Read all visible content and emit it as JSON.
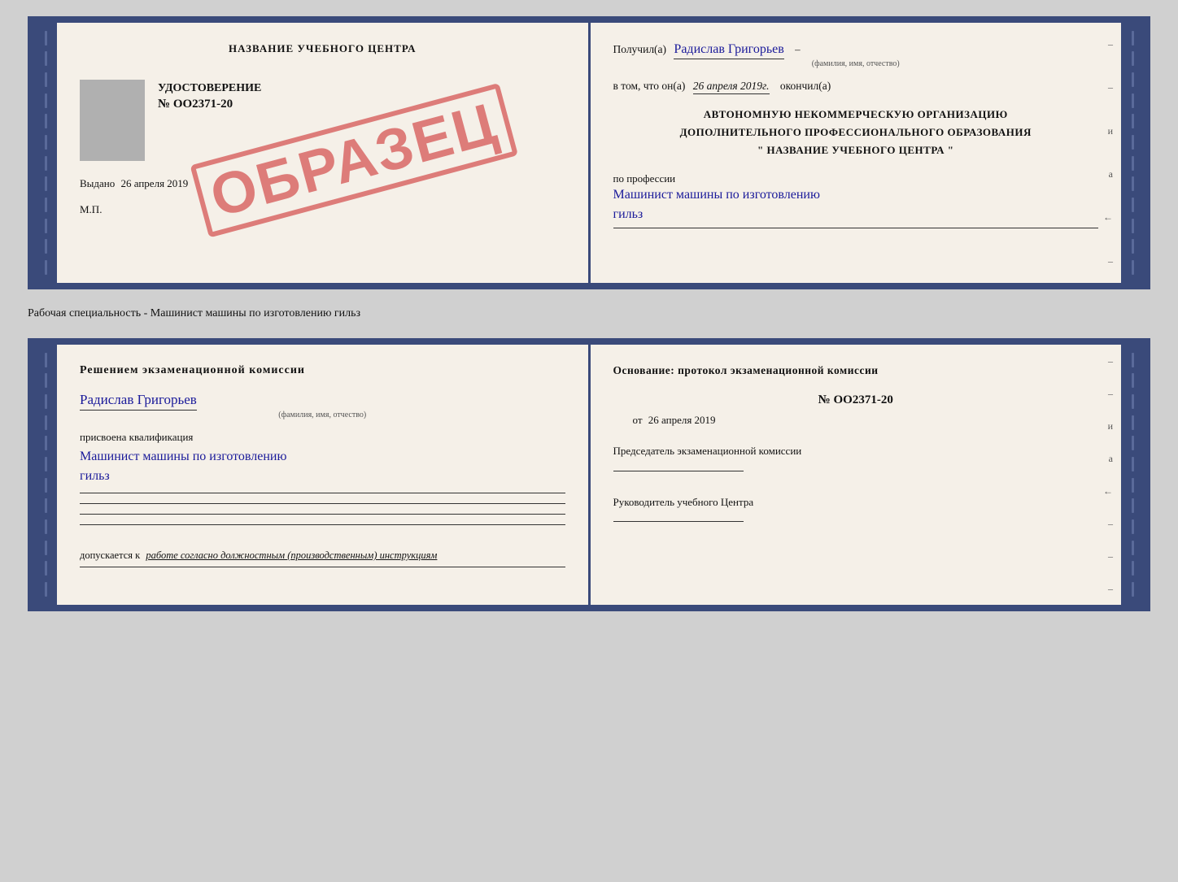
{
  "top_doc": {
    "left": {
      "title": "НАЗВАНИЕ УЧЕБНОГО ЦЕНТРА",
      "stamp": "ОБРАЗЕЦ",
      "cert_label": "УДОСТОВЕРЕНИЕ",
      "cert_number": "№ OO2371-20",
      "vydano_label": "Выдано",
      "vydano_date": "26 апреля 2019",
      "mp": "М.П."
    },
    "right": {
      "poluchil_label": "Получил(а)",
      "person_name": "Радислав Григорьев",
      "famiya_hint": "(фамилия, имя, отчество)",
      "vtom_label": "в том, что он(а)",
      "date": "26 апреля 2019г.",
      "okonchil_label": "окончил(а)",
      "org_line1": "АВТОНОМНУЮ НЕКОММЕРЧЕСКУЮ ОРГАНИЗАЦИЮ",
      "org_line2": "ДОПОЛНИТЕЛЬНОГО ПРОФЕССИОНАЛЬНОГО ОБРАЗОВАНИЯ",
      "org_quote1": "\"",
      "org_name": "НАЗВАНИЕ УЧЕБНОГО ЦЕНТРА",
      "org_quote2": "\"",
      "prof_label": "по профессии",
      "prof_name_line1": "Машинист машины по изготовлению",
      "prof_name_line2": "гильз"
    }
  },
  "separator_label": "Рабочая специальность - Машинист машины по изготовлению гильз",
  "bottom_doc": {
    "left": {
      "resheniem_title": "Решением  экзаменационной  комиссии",
      "person_name": "Радислав Григорьев",
      "famiya_hint": "(фамилия, имя, отчество)",
      "prisvoena_label": "присвоена квалификация",
      "kvalifc_line1": "Машинист машины по изготовлению",
      "kvalifc_line2": "гильз",
      "dopuskaetsya_label": "допускается к",
      "dopuskaetsya_text": "работе согласно должностным (производственным) инструкциям"
    },
    "right": {
      "osnovanie_title": "Основание: протокол экзаменационной  комиссии",
      "protocol_number": "№  OO2371-20",
      "ot_label": "от",
      "ot_date": "26 апреля 2019",
      "predsedatel_title": "Председатель экзаменационной комиссии",
      "rukovoditel_title": "Руководитель учебного Центра"
    }
  },
  "right_marks": {
    "marks": [
      "и",
      "а",
      "←",
      "–",
      "–",
      "–",
      "–"
    ]
  }
}
